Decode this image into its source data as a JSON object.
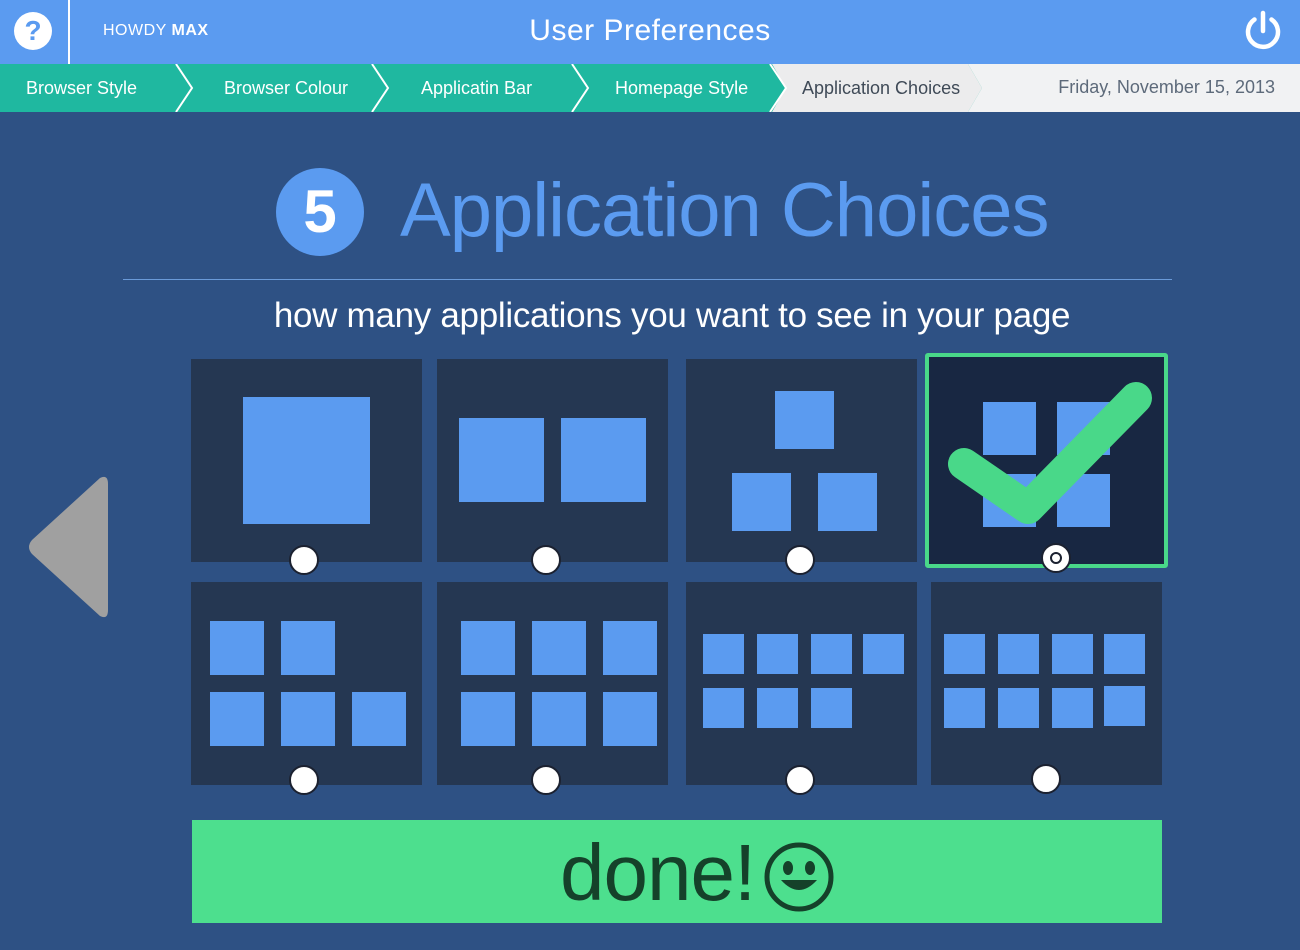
{
  "header": {
    "help_glyph": "?",
    "greeting_prefix": "HOWDY",
    "user_name": "MAX",
    "title": "User Preferences"
  },
  "breadcrumb": {
    "items": [
      {
        "label": "Browser Style",
        "state": "complete"
      },
      {
        "label": "Browser Colour",
        "state": "complete"
      },
      {
        "label": "Applicatin Bar",
        "state": "complete"
      },
      {
        "label": "Homepage Style",
        "state": "complete"
      },
      {
        "label": "Application Choices",
        "state": "current"
      }
    ],
    "date": "Friday, November 15, 2013"
  },
  "step": {
    "number": "5",
    "title": "Application Choices",
    "question": "how many applications  you want to see in your page"
  },
  "options": [
    {
      "apps": 1,
      "selected": false
    },
    {
      "apps": 2,
      "selected": false
    },
    {
      "apps": 3,
      "selected": false
    },
    {
      "apps": 4,
      "selected": true
    },
    {
      "apps": 5,
      "selected": false
    },
    {
      "apps": 6,
      "selected": false
    },
    {
      "apps": 7,
      "selected": false
    },
    {
      "apps": 8,
      "selected": false
    }
  ],
  "done_button": {
    "label": "done!"
  },
  "colors": {
    "background": "#2e5184",
    "header": "#5b9bf0",
    "breadcrumb_complete": "#1fb8a0",
    "tile": "#253752",
    "app_square": "#5b9bf0",
    "selection": "#49d889",
    "done": "#4ddf8e"
  },
  "icons": {
    "help": "question-circle-icon",
    "power": "power-icon",
    "back": "triangle-left-icon",
    "check": "checkmark-icon",
    "smiley": "smiley-face-icon"
  }
}
